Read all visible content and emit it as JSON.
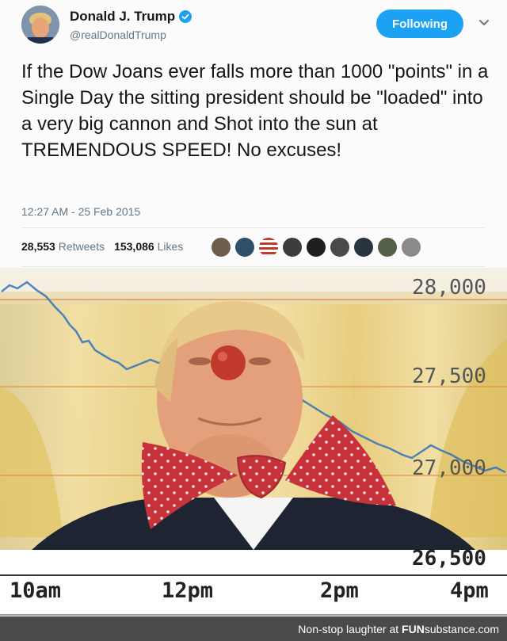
{
  "tweet": {
    "display_name": "Donald J. Trump",
    "handle": "@realDonaldTrump",
    "follow_label": "Following",
    "text": "If the Dow Joans ever falls more than 1000 \"points\" in a Single Day the sitting president should be \"loaded\" into a very big cannon and Shot into the sun at TREMENDOUS SPEED! No excuses!",
    "timestamp": "12:27 AM - 25 Feb 2015",
    "retweets_count": "28,553",
    "retweets_label": "Retweets",
    "likes_count": "153,086",
    "likes_label": "Likes",
    "accent_color": "#1da1f2",
    "verified_icon": "verified-badge-icon"
  },
  "meme": {
    "price_labels": [
      "28,000",
      "27,500",
      "27,000",
      "26,500"
    ],
    "time_labels": [
      "10am",
      "12pm",
      "2pm",
      "4pm"
    ]
  },
  "footer": {
    "text_prefix": "Non-stop laughter at",
    "brand_fun": "FUN",
    "brand_rest": "substance.com"
  }
}
